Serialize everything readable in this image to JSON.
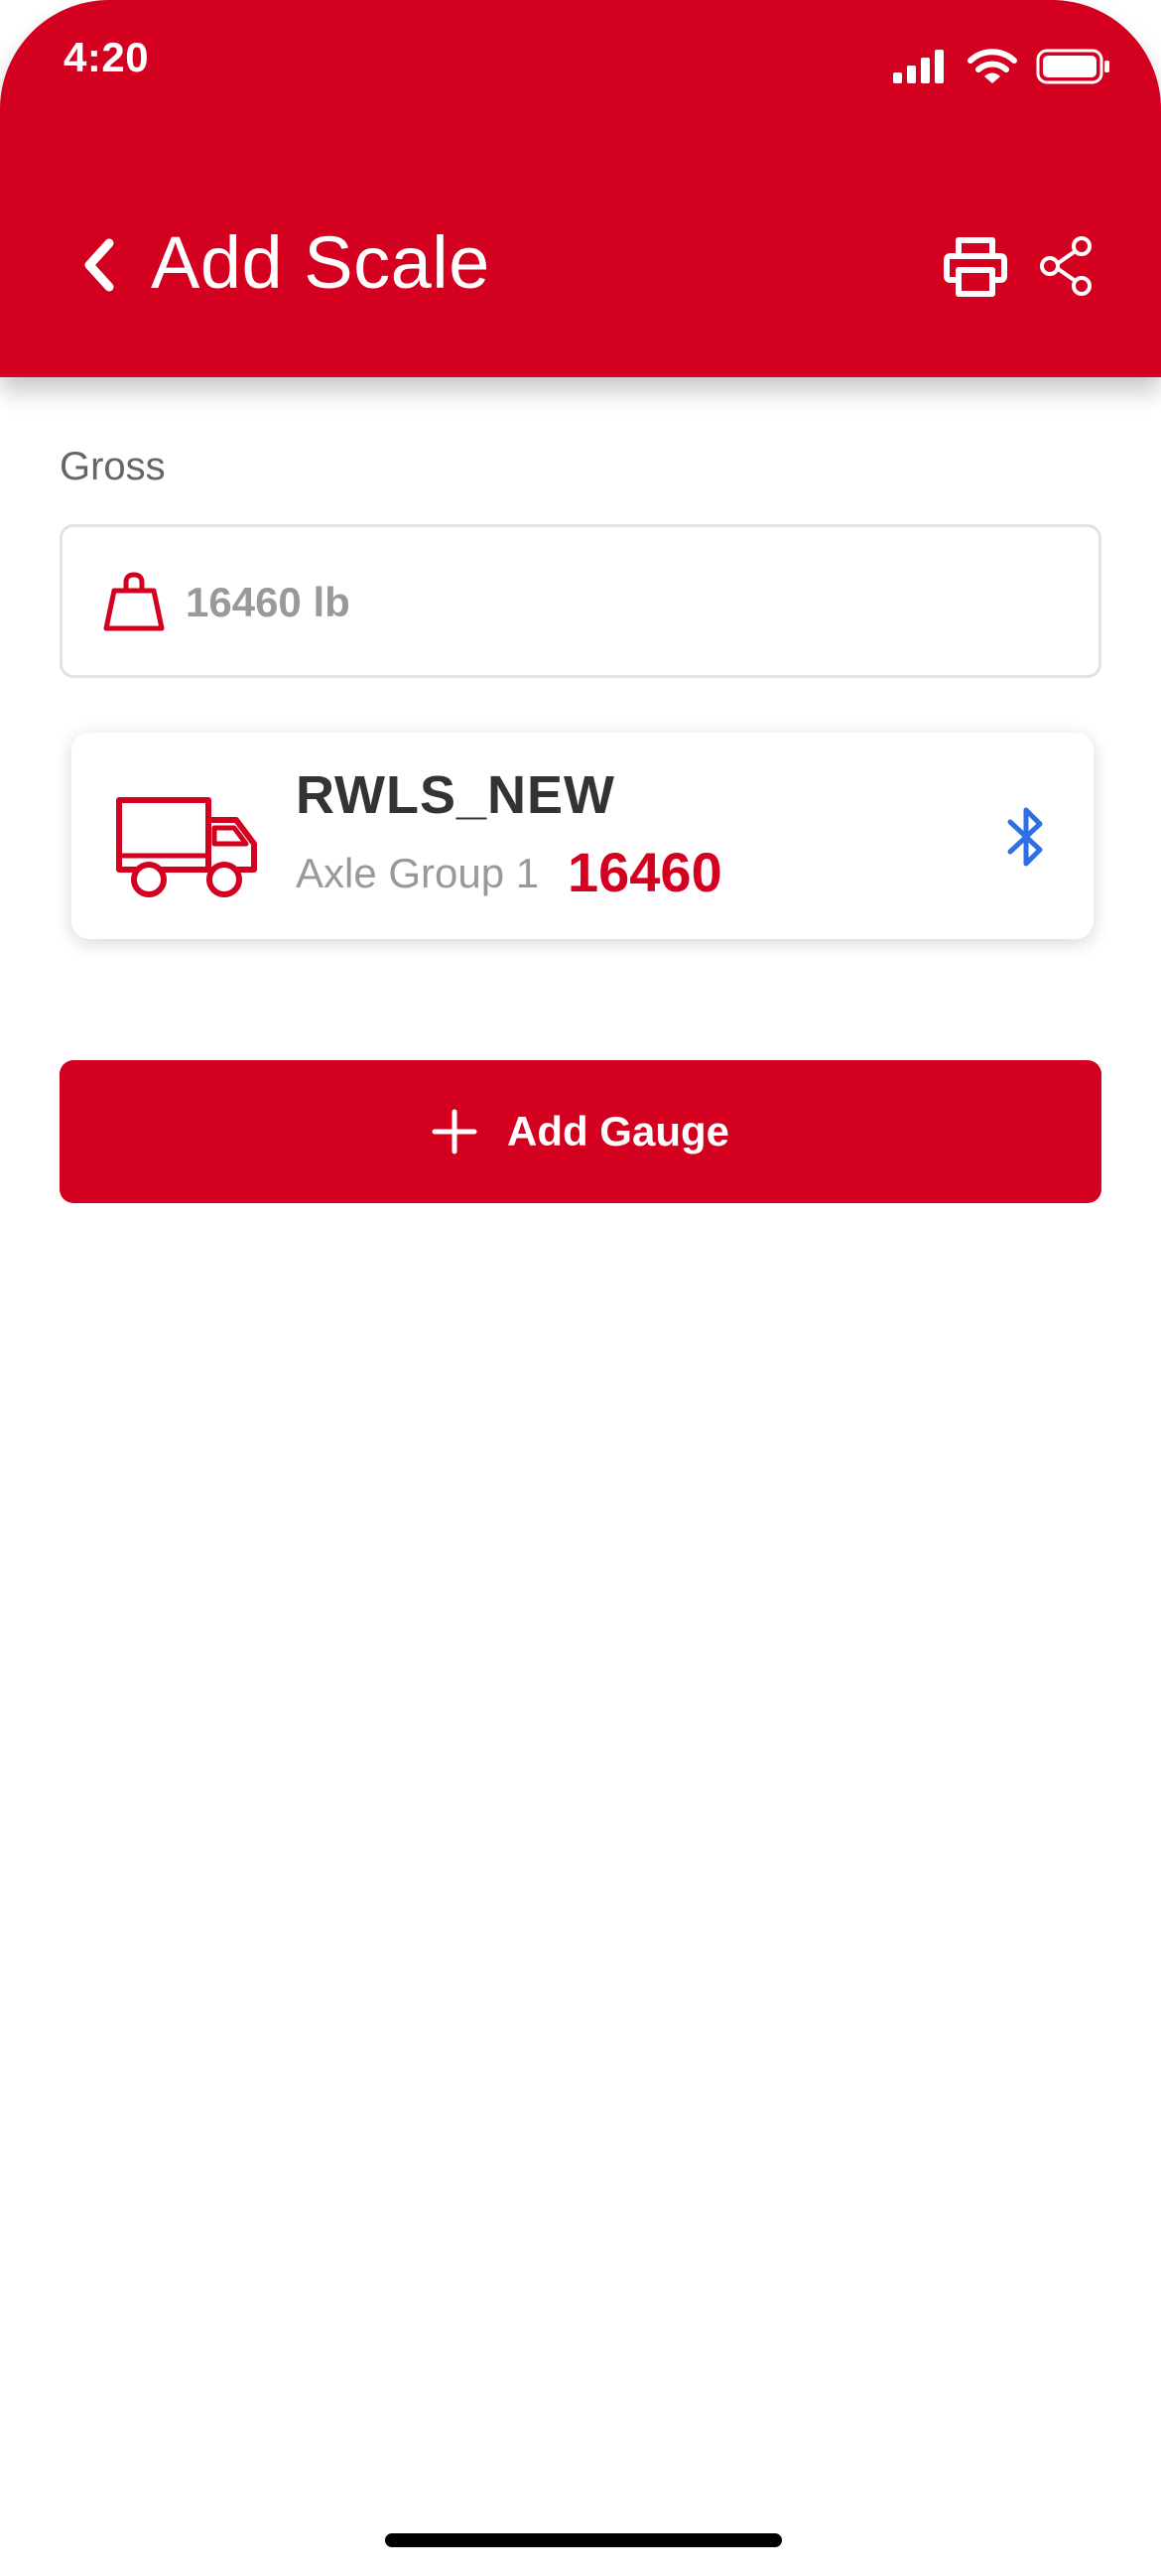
{
  "status_bar": {
    "time": "4:20",
    "icons": [
      "signal-icon",
      "wifi-icon",
      "battery-icon"
    ]
  },
  "header": {
    "title": "Add Scale",
    "back_icon": "chevron-left-icon",
    "actions": [
      "print-icon",
      "share-icon"
    ]
  },
  "gross": {
    "label": "Gross",
    "value": "16460 lb",
    "icon": "weight-icon"
  },
  "scale_card": {
    "name": "RWLS_NEW",
    "axle_label": "Axle Group 1",
    "axle_value": "16460",
    "icon": "truck-icon",
    "connection_icon": "bluetooth-icon"
  },
  "add_gauge": {
    "label": "Add Gauge",
    "icon": "plus-icon"
  },
  "colors": {
    "brand_red": "#D3001F",
    "bluetooth_blue": "#2F6FE4",
    "text_dark": "#333333",
    "text_muted": "#999999"
  }
}
